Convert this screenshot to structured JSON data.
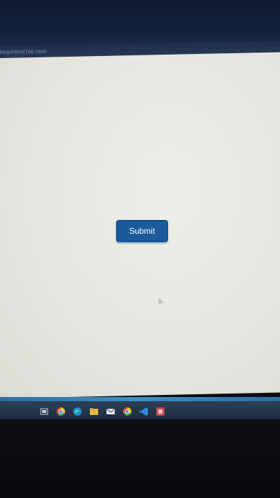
{
  "browser": {
    "address_text": "ktop/Html/166.html"
  },
  "page": {
    "submit_label": "Submit"
  },
  "taskbar": {
    "icons": [
      "taskview-icon",
      "chrome-icon",
      "edge-icon",
      "file-explorer-icon",
      "mail-icon",
      "chrome-icon",
      "vscode-icon",
      "app-icon"
    ]
  },
  "colors": {
    "button_bg": "#1b5a9b",
    "button_text": "#ffffff",
    "page_bg": "#e9e8e2",
    "taskbar_bg": "#2d3f57",
    "taskbar_accent": "#3a90c8"
  }
}
